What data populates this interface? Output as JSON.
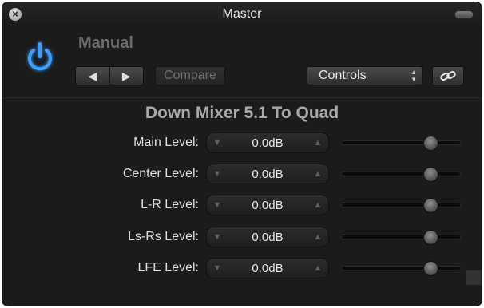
{
  "window": {
    "title": "Master",
    "close_glyph": "×"
  },
  "header": {
    "preset_name": "Manual",
    "nav_prev_glyph": "◀",
    "nav_next_glyph": "▶",
    "compare_label": "Compare",
    "view_select_value": "Controls",
    "view_select_arrows": "▲▼",
    "power_icon": "power-icon",
    "link_icon": "link-icon",
    "accent_color": "#3aa0ff"
  },
  "plugin": {
    "title": "Down Mixer 5.1 To Quad",
    "params": [
      {
        "label": "Main Level:",
        "value": "0.0dB",
        "level": 0.75
      },
      {
        "label": "Center Level:",
        "value": "0.0dB",
        "level": 0.75
      },
      {
        "label": "L-R Level:",
        "value": "0.0dB",
        "level": 0.75
      },
      {
        "label": "Ls-Rs Level:",
        "value": "0.0dB",
        "level": 0.75
      },
      {
        "label": "LFE Level:",
        "value": "0.0dB",
        "level": 0.75
      }
    ],
    "stepper_down_glyph": "▼",
    "stepper_up_glyph": "▲"
  }
}
